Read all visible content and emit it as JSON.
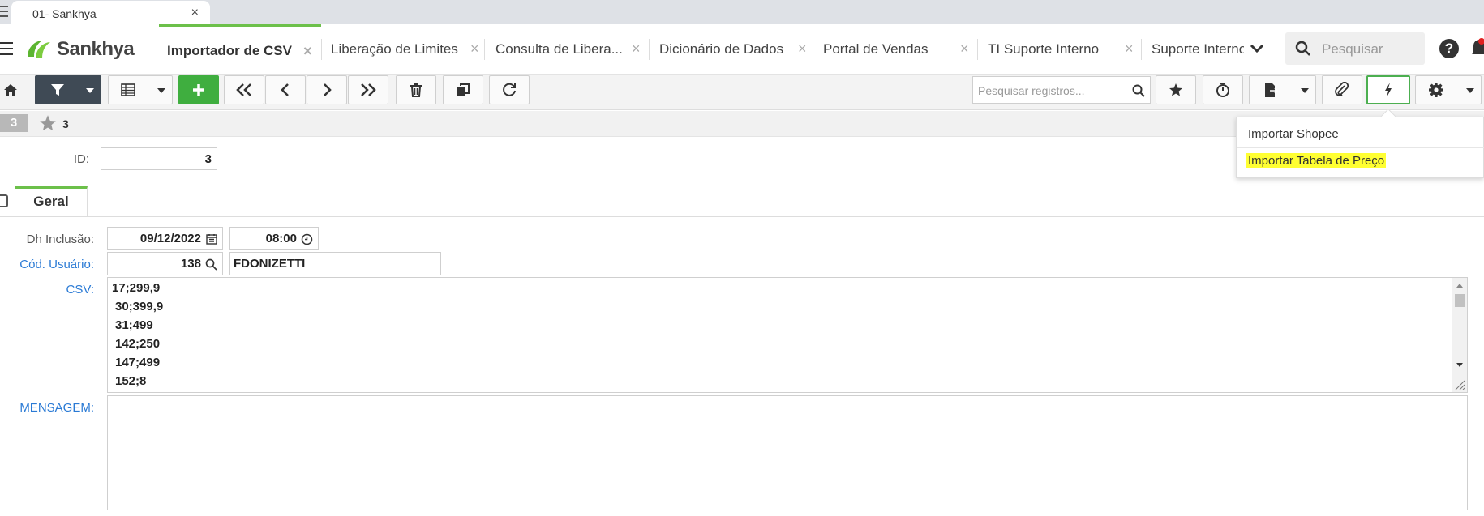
{
  "browser": {
    "tab_title": "01- Sankhya",
    "tab_close": "×"
  },
  "app": {
    "logo_text": "Sankhya",
    "tabs": [
      {
        "label": "Importador de CSV",
        "active": true
      },
      {
        "label": "Liberação de Limites"
      },
      {
        "label": "Consulta de Libera..."
      },
      {
        "label": "Dicionário de Dados"
      },
      {
        "label": "Portal de Vendas"
      },
      {
        "label": "TI Suporte Interno"
      },
      {
        "label": "Suporte Interno"
      }
    ],
    "search_placeholder": "Pesquisar",
    "help_label": "?",
    "accent_color": "#6cc04a"
  },
  "toolbar": {
    "record_search_placeholder": "Pesquisar registros...",
    "icons": [
      "home-icon",
      "filter-icon",
      "grid-icon",
      "add-icon",
      "first-icon",
      "previous-icon",
      "next-icon",
      "last-icon",
      "delete-icon",
      "copy-icon",
      "refresh-icon",
      "star-icon",
      "timer-icon",
      "export-icon",
      "attach-icon",
      "action-icon",
      "settings-icon"
    ]
  },
  "record_bar": {
    "badge": "3",
    "fav_count": "3"
  },
  "action_menu": {
    "items": [
      {
        "label": "Importar Shopee"
      },
      {
        "label": "Importar Tabela de Preço",
        "highlighted": true
      }
    ]
  },
  "form": {
    "id_label": "ID:",
    "id_value": "3",
    "tab_label": "Geral",
    "dh_label": "Dh Inclusão:",
    "dh_date": "09/12/2022",
    "dh_time": "08:00",
    "user_label": "Cód. Usuário:",
    "user_code": "138",
    "user_name": "FDONIZETTI",
    "csv_label": "CSV:",
    "csv_lines": [
      "17;299,9",
      "30;399,9",
      "31;499",
      "142;250",
      "147;499",
      "152;8"
    ],
    "msg_label": "MENSAGEM:",
    "msg_value": ""
  }
}
